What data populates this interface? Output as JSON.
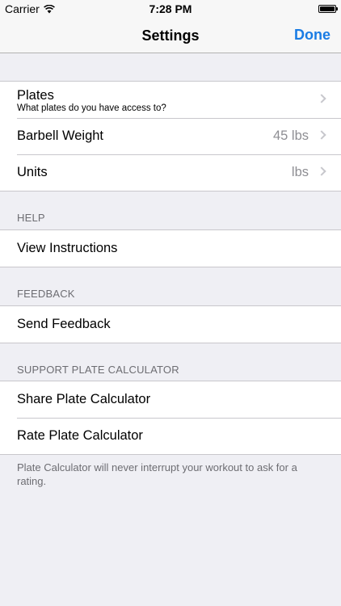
{
  "status_bar": {
    "carrier": "Carrier",
    "time": "7:28 PM"
  },
  "nav": {
    "title": "Settings",
    "done_label": "Done",
    "accent_color": "#1a7ce4"
  },
  "settings": {
    "plates": {
      "title": "Plates",
      "subtitle": "What plates do you have access to?"
    },
    "barbell_weight": {
      "title": "Barbell Weight",
      "value": "45 lbs"
    },
    "units": {
      "title": "Units",
      "value": "lbs"
    }
  },
  "help": {
    "header": "HELP",
    "view_instructions": "View Instructions"
  },
  "feedback": {
    "header": "FEEDBACK",
    "send_feedback": "Send Feedback"
  },
  "support": {
    "header": "SUPPORT PLATE CALCULATOR",
    "share": "Share Plate Calculator",
    "rate": "Rate Plate Calculator",
    "footer": "Plate Calculator will never interrupt your workout to ask for a rating."
  }
}
